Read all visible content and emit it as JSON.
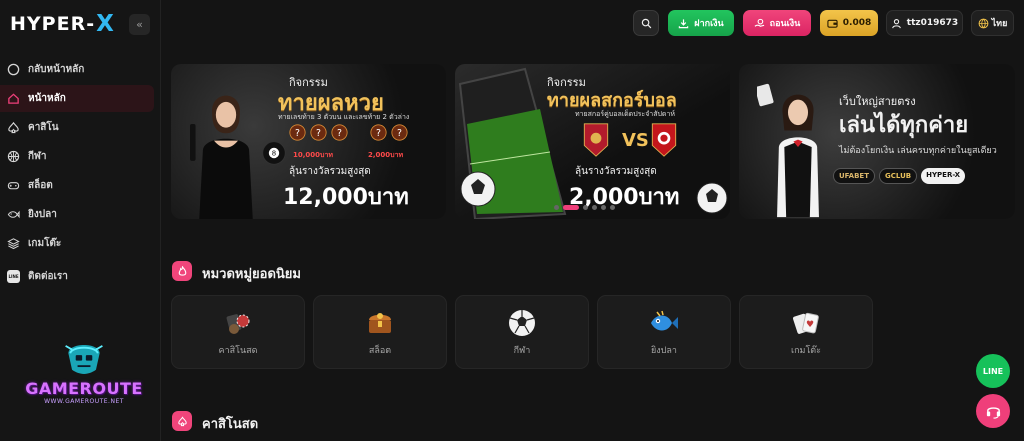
{
  "brand": {
    "logo_text": "HYPER-",
    "logo_x": "X"
  },
  "sidebar": {
    "collapse_glyph": "«",
    "items": [
      {
        "label": "กลับหน้าหลัก",
        "icon": "circle-icon",
        "active": false
      },
      {
        "label": "หน้าหลัก",
        "icon": "home-icon",
        "active": true
      },
      {
        "label": "คาสิโน",
        "icon": "spade-icon",
        "active": false
      },
      {
        "label": "กีฬา",
        "icon": "basketball-icon",
        "active": false
      },
      {
        "label": "สล็อต",
        "icon": "gamepad-icon",
        "active": false
      },
      {
        "label": "ยิงปลา",
        "icon": "fish-icon",
        "active": false
      },
      {
        "label": "เกมโต๊ะ",
        "icon": "layers-icon",
        "active": false
      },
      {
        "label": "ติดต่อเรา",
        "icon": "line-icon",
        "active": false
      }
    ]
  },
  "watermark": {
    "title": "GAMEROUTE",
    "url": "WWW.GAMEROUTE.NET"
  },
  "header": {
    "deposit_label": "ฝากเงิน",
    "withdraw_label": "ถอนเงิน",
    "balance": "0.008",
    "username": "ttz019673",
    "language": "ไทย"
  },
  "banners": {
    "b1": {
      "pretitle": "กิจกรรม",
      "title": "ทายผลหวย",
      "subtitle": "ทายเลขท้าย 3 ตัวบน และเลขท้าย 2 ตัวล่าง",
      "prize_a": "10,000บาท",
      "prize_b": "2,000บาท",
      "caption": "ลุ้นรางวัลรวมสูงสุด",
      "amount": "12,000บาท"
    },
    "b2": {
      "pretitle": "กิจกรรม",
      "title": "ทายผลสกอร์บอล",
      "subtitle": "ทายสกอร์คู่บอลเด็ดประจำสัปดาห์",
      "vs": "VS",
      "caption": "ลุ้นรางวัลรวมสูงสุด",
      "amount": "2,000บาท"
    },
    "b3": {
      "pretitle": "เว็บใหญ่สายตรง",
      "title": "เล่นได้ทุกค่าย",
      "subtitle": "ไม่ต้องโยกเงิน เล่นครบทุกค่ายในยูสเดียว",
      "logo_a": "UFABET",
      "logo_b": "GCLUB",
      "logo_c": "HYPER-X"
    },
    "active_dot": 1
  },
  "popular": {
    "title": "หมวดหมู่ยอดนิยม",
    "categories": [
      {
        "label": "คาสิโนสด",
        "icon": "casino-chips-icon"
      },
      {
        "label": "สล็อต",
        "icon": "treasure-chest-icon"
      },
      {
        "label": "กีฬา",
        "icon": "soccer-ball-icon"
      },
      {
        "label": "ยิงปลา",
        "icon": "fish-icon"
      },
      {
        "label": "เกมโต๊ะ",
        "icon": "playing-cards-icon"
      }
    ]
  },
  "live_casino": {
    "title": "คาสิโนสด"
  },
  "floating": {
    "line_label": "LINE"
  },
  "colors": {
    "accent": "#ef3f7a",
    "deposit": "#22c55e",
    "balance": "#f3c44a",
    "brand_x": "#32b8f2"
  }
}
